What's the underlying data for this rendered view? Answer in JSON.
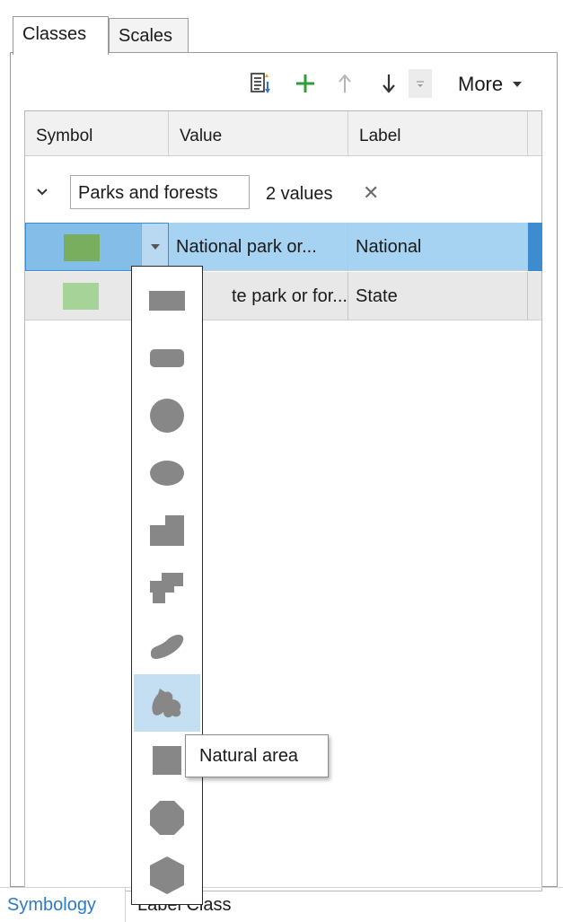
{
  "tabs": {
    "classes": "Classes",
    "scales": "Scales"
  },
  "toolbar": {
    "more_label": "More"
  },
  "grid": {
    "headers": {
      "symbol": "Symbol",
      "value": "Value",
      "label": "Label"
    },
    "group": {
      "name": "Parks and forests",
      "count": "2 values"
    },
    "rows": [
      {
        "value": "National park or...",
        "label": "National",
        "color": "#7aae5f"
      },
      {
        "value": "te park or for...",
        "label": "State",
        "color": "#a5d398"
      }
    ]
  },
  "shape_gallery": {
    "fill_color": "#878787",
    "items": [
      "rectangle",
      "rounded-rectangle",
      "circle",
      "ellipse",
      "stepped-block",
      "cross-block",
      "blob",
      "natural-area",
      "square",
      "octagon",
      "hexagon"
    ],
    "hovered_item": "natural-area"
  },
  "tooltip": {
    "text": "Natural area"
  },
  "bottom_tabs": {
    "symbology": "Symbology",
    "label_class": "Label Class"
  },
  "colors": {
    "accent": "#2d7bc4",
    "selection": "#a6d3f1",
    "add_green": "#2e9e3a"
  }
}
